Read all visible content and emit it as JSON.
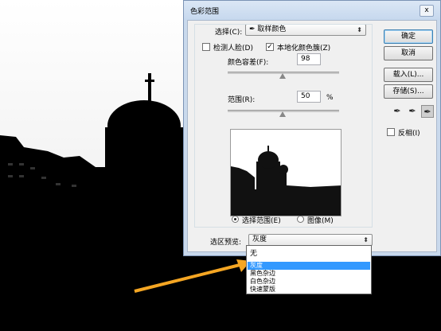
{
  "dialog": {
    "title": "色彩范围",
    "close": "x",
    "select_label": "选择(C):",
    "select_value": "取样颜色",
    "select_icon": "eyedropper-icon",
    "detect_faces": "检测人脸(D)",
    "localized": "本地化颜色簇(Z)",
    "localized_checked": true,
    "fuzziness_label": "颜色容差(F):",
    "fuzziness_value": "98",
    "range_label": "范围(R):",
    "range_value": "50",
    "range_unit": "%",
    "radio_selection": "选择范围(E)",
    "radio_image": "图像(M)",
    "preview_label": "选区预览:",
    "preview_value": "灰度",
    "buttons": {
      "ok": "确定",
      "cancel": "取消",
      "load": "载入(L)...",
      "save": "存储(S)..."
    },
    "invert": "反相(I)",
    "eyedroppers": [
      "eyedropper-icon",
      "eyedropper-plus-icon",
      "eyedropper-minus-icon"
    ]
  },
  "dropdown": {
    "top_item": "无",
    "items": [
      "灰度",
      "黑色杂边",
      "白色杂边",
      "快速蒙版"
    ],
    "selected": 0
  },
  "colors": {
    "selection": "#3399ff",
    "arrow": "#f5a623"
  }
}
